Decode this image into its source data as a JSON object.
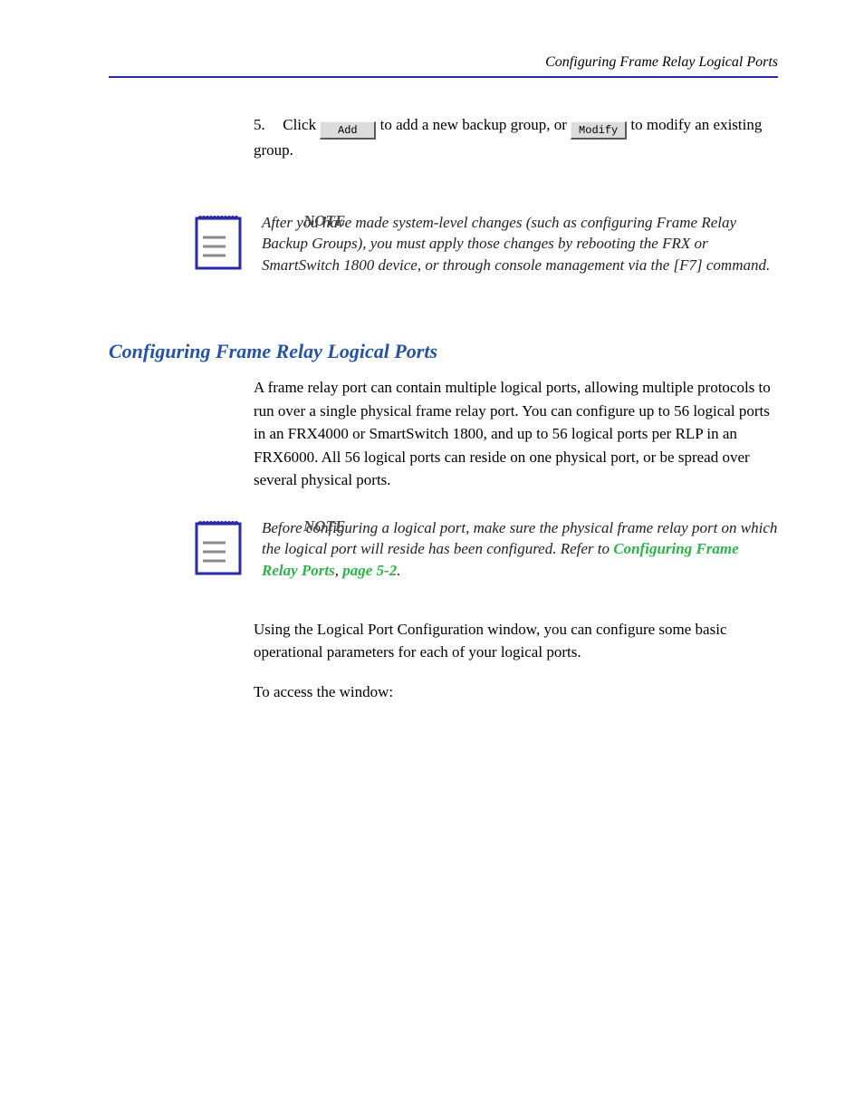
{
  "running_head": "Configuring Frame Relay Logical Ports",
  "step": {
    "number": "5.",
    "pre": "Click ",
    "btn_add": "Add",
    "mid": " to add a new backup group, or ",
    "btn_modify": "Modify",
    "post": " to modify an existing group."
  },
  "note1": {
    "label": "NOTE",
    "text": "After you have made system-level changes (such as configuring Frame Relay Backup Groups), you must apply those changes by rebooting the FRX or SmartSwitch 1800 device, or through console management via the [F7] command."
  },
  "heading": "Configuring Frame Relay Logical Ports",
  "body1": "A frame relay port can contain multiple logical ports, allowing multiple protocols to run over a single physical frame relay port. You can configure up to 56 logical ports in an FRX4000 or SmartSwitch 1800, and up to 56 logical ports per RLP in an FRX6000. All 56 logical ports can reside on one physical port, or be spread over several physical ports.",
  "note2": {
    "label": "NOTE",
    "text_pre": "Before configuring a logical port, make sure the physical frame relay port on which the logical port will reside has been configured. Refer to ",
    "link_text": "Configuring Frame Relay Ports",
    "after_link": ", ",
    "page_ref": "page 5-2",
    "after_page": "."
  },
  "body2": "Using the Logical Port Configuration window, you can configure some basic operational parameters for each of your logical ports.",
  "body3": "To access the window:"
}
